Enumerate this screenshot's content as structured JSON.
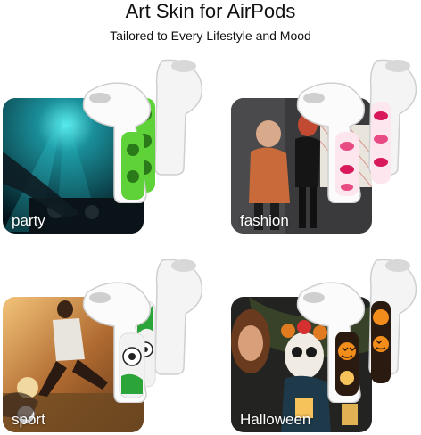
{
  "header": {
    "title": "Art Skin for AirPods",
    "subtitle": "Tailored to Every Lifestyle and Mood"
  },
  "tiles": [
    {
      "caption": "party",
      "skin": "green-skulls",
      "colors": {
        "bg": "#0b3a44",
        "accent": "#18c0c8",
        "skin": "#5fd23a"
      }
    },
    {
      "caption": "fashion",
      "skin": "pink-lips",
      "colors": {
        "bg": "#3b3b3d",
        "accent": "#c0392b",
        "skin": "#e84b83"
      }
    },
    {
      "caption": "sport",
      "skin": "soccer-balls",
      "colors": {
        "bg": "#b0733a",
        "accent": "#e0a050",
        "skin": "#2ba43a"
      }
    },
    {
      "caption": "Halloween",
      "skin": "pumpkins",
      "colors": {
        "bg": "#2a2a28",
        "accent": "#e07a20",
        "skin": "#f28c1a"
      }
    }
  ]
}
